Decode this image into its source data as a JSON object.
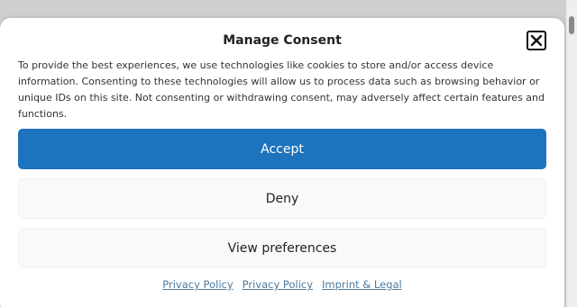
{
  "dialog": {
    "title": "Manage Consent",
    "message": "To provide the best experiences, we use technologies like cookies to store and/or access device information. Consenting to these technologies will allow us to process data such as browsing behavior or unique IDs on this site. Not consenting or withdrawing consent, may adversely affect certain features and functions.",
    "close_icon": "close-icon",
    "accept_label": "Accept",
    "deny_label": "Deny",
    "preferences_label": "View preferences",
    "links": [
      {
        "label": "Privacy Policy"
      },
      {
        "label": "Privacy Policy"
      },
      {
        "label": "Imprint & Legal"
      }
    ]
  },
  "colors": {
    "accent": "#1e73be",
    "link": "#4d7a9e",
    "secondary_button_bg": "#f9f9f9"
  }
}
